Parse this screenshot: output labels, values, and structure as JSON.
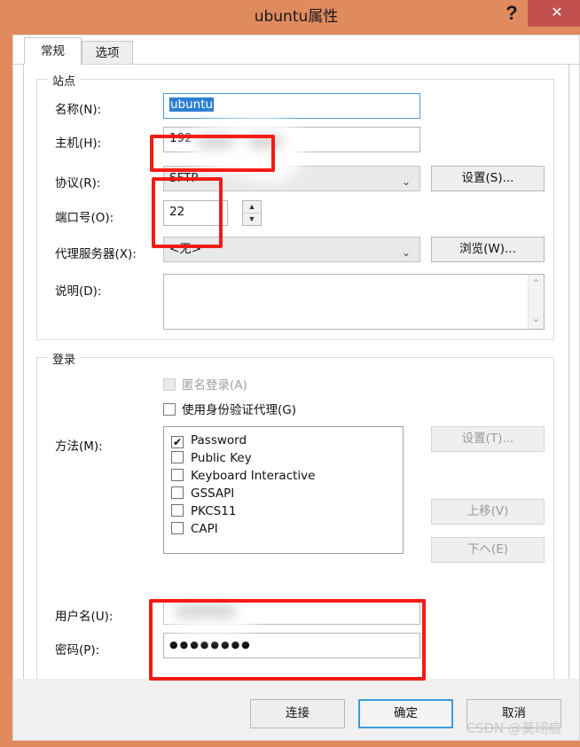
{
  "window": {
    "title": "ubuntu属性",
    "help_label": "?",
    "close_label": "✕",
    "titlebar_color": "#e08a5f",
    "close_color": "#c2504e"
  },
  "tabs": [
    {
      "label": "常规",
      "active": true
    },
    {
      "label": "选项",
      "active": false
    }
  ],
  "site_group": {
    "title": "站点",
    "name_label": "名称(N):",
    "name_value": "ubuntu",
    "host_label": "主机(H):",
    "host_value": "192",
    "protocol_label": "协议(R):",
    "protocol_value": "SFTP",
    "protocol_settings_button": "设置(S)...",
    "port_label": "端口号(O):",
    "port_value": "22",
    "proxy_label": "代理服务器(X):",
    "proxy_value": "<无>",
    "proxy_browse_button": "浏览(W)...",
    "description_label": "说明(D):",
    "description_value": ""
  },
  "login_group": {
    "title": "登录",
    "anonymous_label": "匿名登录(A)",
    "anonymous_checked": false,
    "anonymous_disabled": true,
    "agent_label": "使用身份验证代理(G)",
    "agent_checked": false,
    "method_label": "方法(M):",
    "methods": [
      {
        "label": "Password",
        "checked": true
      },
      {
        "label": "Public Key",
        "checked": false
      },
      {
        "label": "Keyboard Interactive",
        "checked": false
      },
      {
        "label": "GSSAPI",
        "checked": false
      },
      {
        "label": "PKCS11",
        "checked": false
      },
      {
        "label": "CAPI",
        "checked": false
      }
    ],
    "method_settings_button": "设置(T)...",
    "move_up_button": "上移(V)",
    "move_down_button": "下へ(E)",
    "username_label": "用户名(U):",
    "username_value": "",
    "password_label": "密码(P):",
    "password_value": "●●●●●●●●"
  },
  "footer": {
    "connect_button": "连接",
    "ok_button": "确定",
    "cancel_button": "取消"
  },
  "watermark": "CSDN @莫翊痕",
  "icons": {
    "chevron_down": "⌄",
    "spinner_up": "▲",
    "spinner_down": "▼",
    "scroll_up": "⌃",
    "scroll_down": "⌄",
    "check": "✔"
  }
}
